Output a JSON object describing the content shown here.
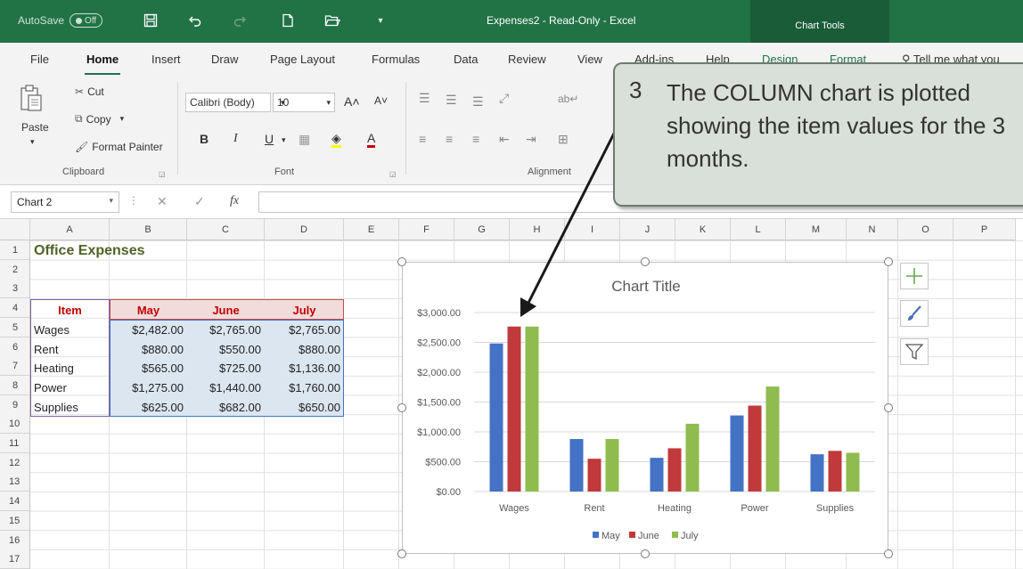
{
  "titlebar": {
    "autosave_label": "AutoSave",
    "autosave_state": "Off",
    "doc_title": "Expenses2  -  Read-Only  -  Excel",
    "context_tab": "Chart Tools",
    "bg_color": "#217346"
  },
  "tabs": [
    "File",
    "Home",
    "Insert",
    "Draw",
    "Page Layout",
    "Formulas",
    "Data",
    "Review",
    "View",
    "Add-ins",
    "Help",
    "Design",
    "Format",
    "Tell me what you"
  ],
  "ribbon": {
    "clipboard": {
      "paste": "Paste",
      "cut": "Cut",
      "copy": "Copy",
      "format_painter": "Format Painter",
      "label": "Clipboard"
    },
    "font": {
      "name": "Calibri (Body)",
      "size": "10",
      "label": "Font"
    },
    "alignment": {
      "label": "Alignment"
    }
  },
  "formula_bar": {
    "name_box": "Chart 2",
    "fx": "fx",
    "formula": ""
  },
  "columns": [
    "A",
    "B",
    "C",
    "D",
    "E",
    "F",
    "G",
    "H",
    "I",
    "J",
    "K",
    "L",
    "M",
    "N",
    "O",
    "P"
  ],
  "rows": [
    "1",
    "2",
    "3",
    "4",
    "5",
    "6",
    "7",
    "8",
    "9",
    "10",
    "11",
    "12",
    "13",
    "14",
    "15",
    "16",
    "17"
  ],
  "sheet": {
    "title": "Office Expenses",
    "headers": [
      "Item",
      "May",
      "June",
      "July"
    ],
    "table": [
      {
        "item": "Wages",
        "may": "$2,482.00",
        "june": "$2,765.00",
        "july": "$2,765.00"
      },
      {
        "item": "Rent",
        "may": "$880.00",
        "june": "$550.00",
        "july": "$880.00"
      },
      {
        "item": "Heating",
        "may": "$565.00",
        "june": "$725.00",
        "july": "$1,136.00"
      },
      {
        "item": "Power",
        "may": "$1,275.00",
        "june": "$1,440.00",
        "july": "$1,760.00"
      },
      {
        "item": "Supplies",
        "may": "$625.00",
        "june": "$682.00",
        "july": "$650.00"
      }
    ]
  },
  "chart_data": {
    "type": "bar",
    "title": "Chart Title",
    "categories": [
      "Wages",
      "Rent",
      "Heating",
      "Power",
      "Supplies"
    ],
    "series": [
      {
        "name": "May",
        "values": [
          2482,
          880,
          565,
          1275,
          625
        ],
        "color": "#4472c4"
      },
      {
        "name": "June",
        "values": [
          2765,
          550,
          725,
          1440,
          682
        ],
        "color": "#c0393b"
      },
      {
        "name": "July",
        "values": [
          2765,
          880,
          1136,
          1760,
          650
        ],
        "color": "#8fbc4f"
      }
    ],
    "yticks": [
      "$0.00",
      "$500.00",
      "$1,000.00",
      "$1,500.00",
      "$2,000.00",
      "$2,500.00",
      "$3,000.00"
    ],
    "ylim": [
      0,
      3000
    ],
    "grid": true,
    "legend": "bottom"
  },
  "callout": {
    "number": "3",
    "text": "The COLUMN chart is plotted showing the item values for the 3 months."
  }
}
